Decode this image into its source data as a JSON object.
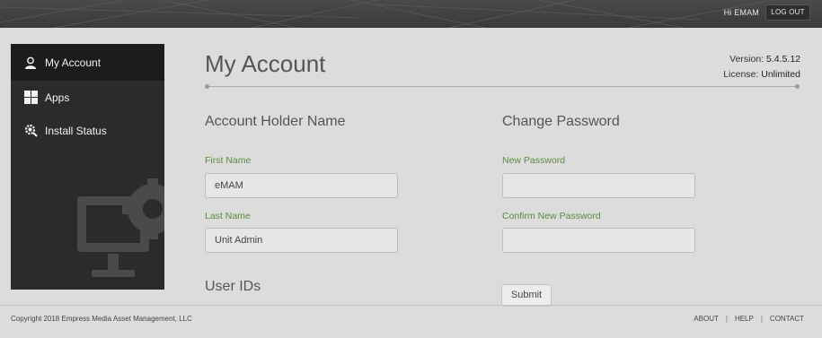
{
  "header": {
    "greeting": "Hi EMAM",
    "logout_label": "LOG OUT"
  },
  "sidebar": {
    "items": [
      {
        "label": "My Account",
        "icon": "user-icon",
        "active": true
      },
      {
        "label": "Apps",
        "icon": "grid-icon",
        "active": false
      },
      {
        "label": "Install Status",
        "icon": "gear-search-icon",
        "active": false
      }
    ]
  },
  "main": {
    "title": "My Account",
    "version_label": "Version:",
    "version_value": "5.4.5.12",
    "license_label": "License:",
    "license_value": "Unlimited",
    "account_section": {
      "title": "Account Holder Name",
      "first_name_label": "First Name",
      "first_name_value": "eMAM",
      "last_name_label": "Last Name",
      "last_name_value": "Unit Admin"
    },
    "password_section": {
      "title": "Change Password",
      "new_password_label": "New Password",
      "new_password_value": "",
      "confirm_password_label": "Confirm New Password",
      "confirm_password_value": "",
      "submit_label": "Submit"
    },
    "user_ids_title": "User IDs"
  },
  "footer": {
    "copyright": "Copyright 2018 Empress Media Asset Management, LLC",
    "links": [
      "ABOUT",
      "HELP",
      "CONTACT"
    ]
  },
  "colors": {
    "topbar": "#3f3f3f",
    "sidebar": "#2b2b2b",
    "label_green": "#5b8a3a",
    "page_bg": "#dcdcdc"
  }
}
